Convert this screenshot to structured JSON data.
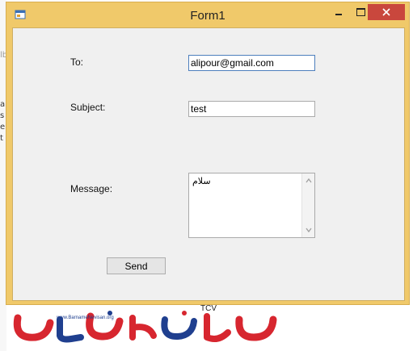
{
  "window": {
    "title": "Form1"
  },
  "form": {
    "to_label": "To:",
    "to_value": "alipour@gmail.com",
    "subject_label": "Subject:",
    "subject_value": "test",
    "message_label": "Message:",
    "message_value": "سلام",
    "send_label": "Send"
  },
  "background": {
    "fragments": [
      "lb",
      "a",
      "s",
      "e",
      "t",
      "TCV"
    ]
  },
  "logo": {
    "site_text": "www.BarnameNevisan.org"
  },
  "colors": {
    "titlebar": "#f0c96a",
    "close_button": "#c9473d",
    "client": "#f0f0f0",
    "logo_red": "#d7262f",
    "logo_blue": "#1f3f8f"
  },
  "icons": [
    "app-icon",
    "minimize-icon",
    "maximize-icon",
    "close-icon",
    "scroll-up-icon",
    "scroll-down-icon"
  ]
}
